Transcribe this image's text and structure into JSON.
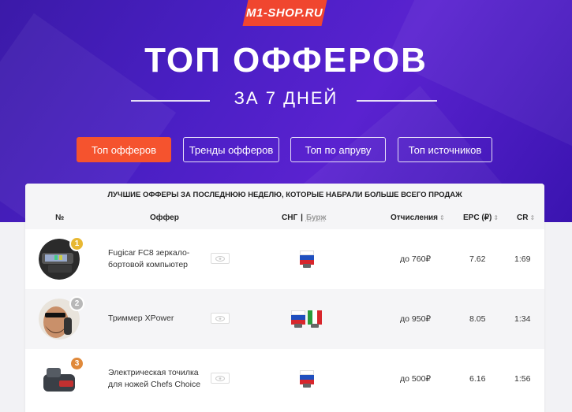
{
  "logo": "M1-SHOP.RU",
  "title": "ТОП ОФФЕРОВ",
  "subtitle": "ЗА 7 ДНЕЙ",
  "tabs": [
    {
      "label": "Топ офферов",
      "active": true
    },
    {
      "label": "Тренды офферов",
      "active": false
    },
    {
      "label": "Топ по апруву",
      "active": false
    },
    {
      "label": "Топ источников",
      "active": false
    }
  ],
  "table": {
    "caption": "ЛУЧШИЕ ОФФЕРЫ ЗА ПОСЛЕДНЮЮ НЕДЕЛЮ, КОТОРЫЕ НАБРАЛИ БОЛЬШЕ ВСЕГО ПРОДАЖ",
    "headers": {
      "num": "№",
      "offer": "Оффер",
      "cis": "СНГ",
      "separator": "|",
      "burj": "Бурж",
      "payout": "Отчисления",
      "epc": "EPC (₽)",
      "cr": "CR",
      "sort_glyph": "⇕"
    },
    "rows": [
      {
        "rank": "1",
        "rank_color": "#e8b832",
        "name_lines": [
          "Fugicar FC8 зеркало-",
          "бортовой компьютер"
        ],
        "flags": [
          "ru"
        ],
        "payout": "до 760₽",
        "epc": "7.62",
        "cr": "1:69",
        "img": "dashcam-icon"
      },
      {
        "rank": "2",
        "rank_color": "#b8b8b8",
        "name_lines": [
          "Триммер XPower"
        ],
        "flags": [
          "ru",
          "it"
        ],
        "payout": "до 950₽",
        "epc": "8.05",
        "cr": "1:34",
        "img": "trimmer-icon"
      },
      {
        "rank": "3",
        "rank_color": "#e0893a",
        "name_lines": [
          "Электрическая точилка",
          "для ножей Chefs Choice"
        ],
        "flags": [
          "ru"
        ],
        "payout": "до 500₽",
        "epc": "6.16",
        "cr": "1:56",
        "img": "sharpener-icon"
      }
    ]
  }
}
